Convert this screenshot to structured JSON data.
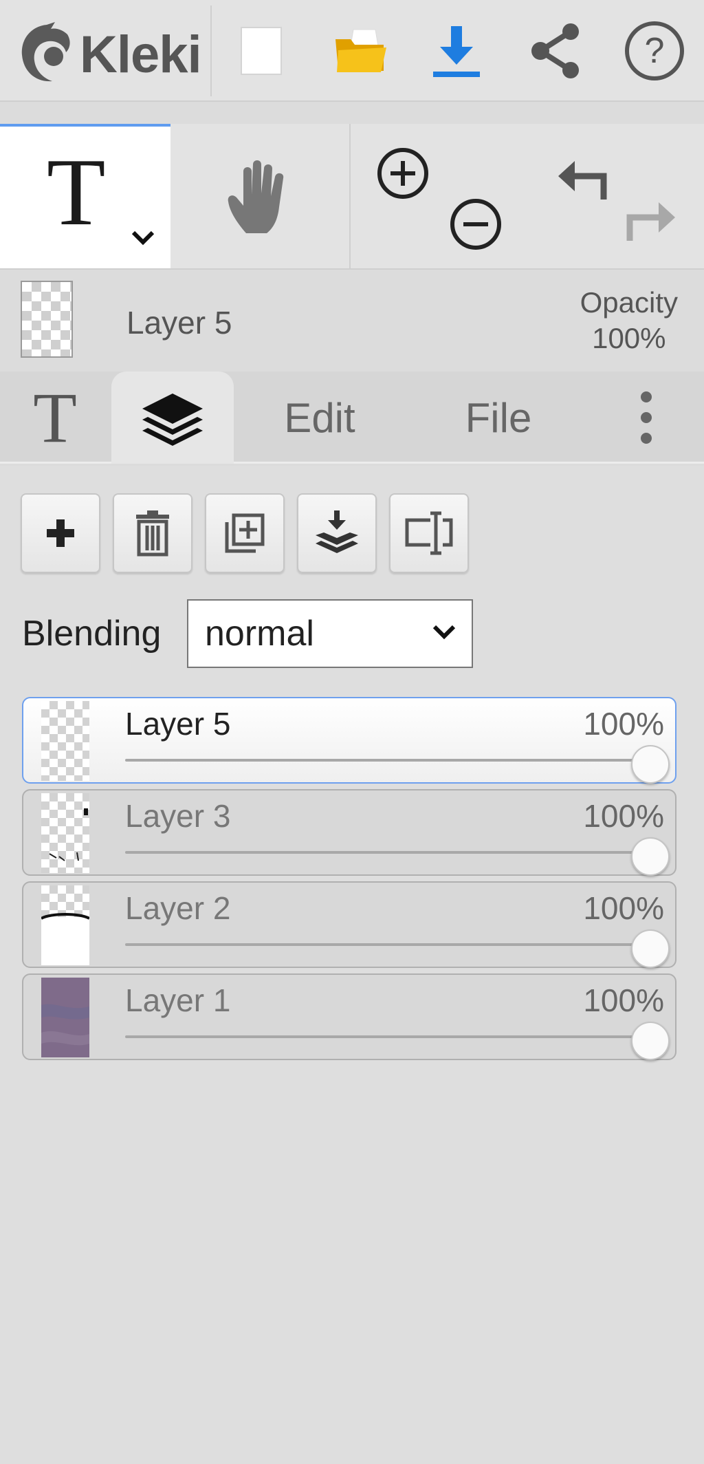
{
  "app": {
    "logo_text": "Kleki"
  },
  "toolbar": {
    "items": [
      {
        "icon": "new-document-icon"
      },
      {
        "icon": "open-folder-icon"
      },
      {
        "icon": "download-icon"
      },
      {
        "icon": "share-icon"
      },
      {
        "icon": "help-icon"
      }
    ]
  },
  "tools": {
    "active_tool": "text",
    "items": [
      {
        "icon": "text-tool-icon",
        "glyph": "T"
      },
      {
        "icon": "hand-tool-icon"
      },
      {
        "icon": "zoom-in-icon"
      },
      {
        "icon": "zoom-out-icon"
      },
      {
        "icon": "undo-icon"
      },
      {
        "icon": "redo-icon"
      }
    ]
  },
  "current_layer": {
    "name": "Layer 5",
    "opacity_label": "Opacity",
    "opacity_value": "100%"
  },
  "tabs": [
    {
      "label": "T",
      "icon": "text-tab-icon"
    },
    {
      "label": "",
      "icon": "layers-icon",
      "active": true
    },
    {
      "label": "Edit"
    },
    {
      "label": "File"
    },
    {
      "label": "",
      "icon": "more-vertical-icon"
    }
  ],
  "layer_actions": [
    {
      "icon": "add-layer-icon"
    },
    {
      "icon": "delete-layer-icon"
    },
    {
      "icon": "duplicate-layer-icon"
    },
    {
      "icon": "merge-down-icon"
    },
    {
      "icon": "rename-layer-icon"
    }
  ],
  "blending": {
    "label": "Blending",
    "value": "normal"
  },
  "layers": [
    {
      "name": "Layer 5",
      "opacity": "100%",
      "opacity_fraction": 1.0,
      "active": true
    },
    {
      "name": "Layer 3",
      "opacity": "100%",
      "opacity_fraction": 1.0,
      "active": false
    },
    {
      "name": "Layer 2",
      "opacity": "100%",
      "opacity_fraction": 1.0,
      "active": false
    },
    {
      "name": "Layer 1",
      "opacity": "100%",
      "opacity_fraction": 1.0,
      "active": false
    }
  ],
  "colors": {
    "accent": "#5f9cf0",
    "download_blue": "#1e7de0",
    "folder_yellow": "#f2b705",
    "layer1_fill": "#7f6b8a"
  }
}
